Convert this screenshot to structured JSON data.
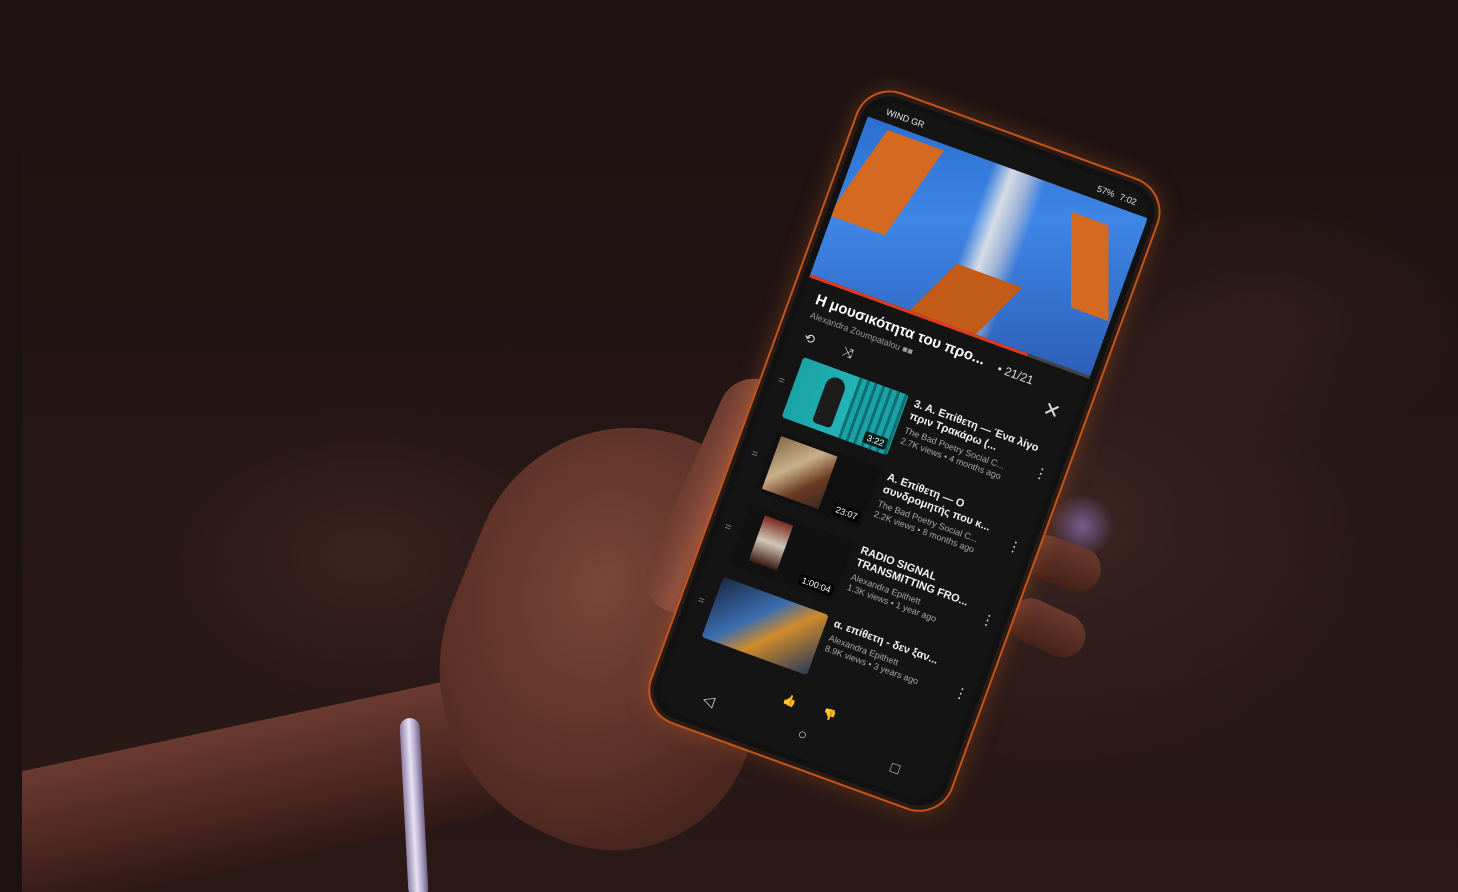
{
  "status_bar": {
    "left_text": "WIND GR",
    "battery": "57%",
    "time": "7:02"
  },
  "video": {
    "caption_line1": "",
    "caption_line2": "",
    "progress_fraction": 0.78
  },
  "playlist": {
    "title": "Η μουσικότητα του προ...",
    "subtitle": "Alexandra Zoumpatalou",
    "subtitle_tag": "■■",
    "position": "• 21/21",
    "close": "✕",
    "repeat_icon": "⟲",
    "shuffle_icon": "⤨",
    "items": [
      {
        "title": "3. Α. Επίθετη — Ένα λίγο πριν Τρακάρω (...",
        "channel": "The Bad Poetry Social C...",
        "views": "2.7K views • 4 months ago",
        "duration": "3:22"
      },
      {
        "title": "Α. Επίθετη — Ο συνδρομητής που κ...",
        "channel": "The Bad Poetry Social C...",
        "views": "2.2K views • 8 months ago",
        "duration": "23:07"
      },
      {
        "title": "RADIO SIGNAL TRANSMITTING FRO...",
        "channel": "Alexandra Epithett",
        "views": "1.3K views • 1 year ago",
        "duration": "1:00:04"
      },
      {
        "title": "α. επίθετη - δεν ξαν...",
        "channel": "Alexandra Epithett",
        "views": "8.9K views • 3 years ago",
        "duration": ""
      }
    ]
  },
  "nav": {
    "back": "◁",
    "home": "○",
    "recents": "□"
  },
  "actions": {
    "like": "👍",
    "dislike": "👎"
  },
  "colors": {
    "phone_rim": "#c2541c",
    "progress": "#e03a1e",
    "caption": "#f2c21a"
  }
}
